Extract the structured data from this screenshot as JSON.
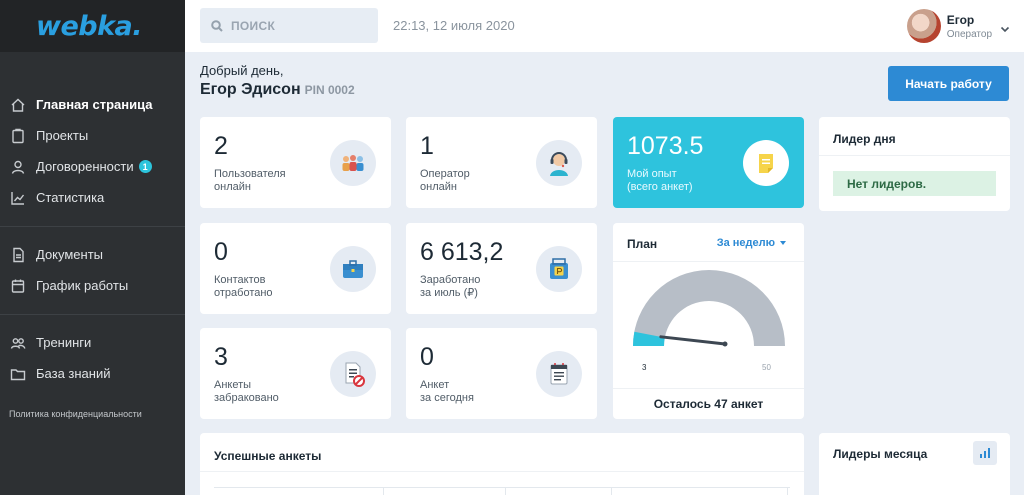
{
  "app": {
    "logo": "webka."
  },
  "sidebar": {
    "items": [
      {
        "label": "Главная страница",
        "icon": "home-icon"
      },
      {
        "label": "Проекты",
        "icon": "clipboard-icon"
      },
      {
        "label": "Договоренности",
        "icon": "user-icon",
        "badge": "1"
      },
      {
        "label": "Статистика",
        "icon": "chart-icon"
      },
      {
        "label": "Документы",
        "icon": "document-icon"
      },
      {
        "label": "График работы",
        "icon": "calendar-icon"
      },
      {
        "label": "Тренинги",
        "icon": "users-icon"
      },
      {
        "label": "База знаний",
        "icon": "folder-icon"
      }
    ],
    "privacy": "Политика конфиденциальности"
  },
  "topbar": {
    "search_placeholder": "ПОИСК",
    "datetime": "22:13, 12 июля 2020",
    "user": {
      "name": "Егор",
      "role": "Оператор"
    }
  },
  "greeting": {
    "hello": "Добрый день,",
    "name": "Егор Эдисон",
    "pin": "PIN 0002"
  },
  "start_button": "Начать работу",
  "stats": [
    {
      "value": "2",
      "label1": "Пользователя",
      "label2": "онлайн",
      "icon": "users-group-icon"
    },
    {
      "value": "1",
      "label1": "Оператор",
      "label2": "онлайн",
      "icon": "operator-headset-icon"
    },
    {
      "value": "0",
      "label1": "Контактов",
      "label2": "отработано",
      "icon": "briefcase-icon"
    },
    {
      "value": "6 613,2",
      "label1": "Заработано",
      "label2": "за июль (₽)",
      "icon": "money-bag-icon"
    },
    {
      "value": "3",
      "label1": "Анкеты",
      "label2": "забраковано",
      "icon": "rejected-document-icon"
    },
    {
      "value": "0",
      "label1": "Анкет",
      "label2": "за сегодня",
      "icon": "calendar-list-icon"
    }
  ],
  "experience": {
    "value": "1073.5",
    "label1": "Мой опыт",
    "label2": "(всего анкет)",
    "icon": "sticky-note-icon"
  },
  "leader_day": {
    "title": "Лидер дня",
    "empty": "Нет лидеров."
  },
  "plan": {
    "title": "План",
    "period": "За неделю",
    "current": 3,
    "min_label": "3",
    "max": 50,
    "max_label": "50",
    "remaining": "Осталось 47 анкет"
  },
  "success": {
    "title": "Успешные анкеты"
  },
  "leaders_month": {
    "title": "Лидеры месяца"
  },
  "colors": {
    "accent": "#2d8ad4",
    "cyan": "#2ec3dd",
    "sidebar": "#2d3033",
    "gauge_bg": "#b7bec7"
  }
}
